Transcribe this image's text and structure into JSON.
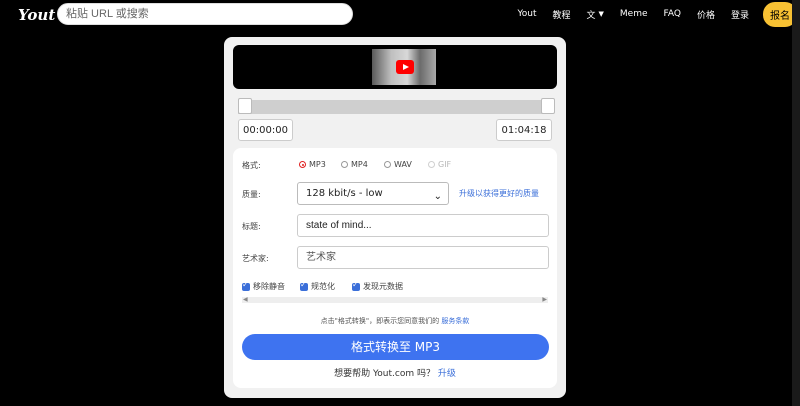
{
  "header": {
    "logo_text": "Yout",
    "search_placeholder": "粘贴 URL 或搜索",
    "nav": {
      "yout": "Yout",
      "tutorial": "教程",
      "language_icon": "文",
      "meme": "Meme",
      "faq": "FAQ",
      "pricing": "价格",
      "login": "登录",
      "signup": "报名"
    }
  },
  "player": {
    "start_time": "00:00:00",
    "end_time": "01:04:18"
  },
  "form": {
    "format_label": "格式:",
    "formats": [
      "MP3",
      "MP4",
      "WAV",
      "GIF"
    ],
    "selected_format": "MP3",
    "quality_label": "质量:",
    "quality_value": "128 kbit/s - low",
    "quality_upgrade": "升级以获得更好的质量",
    "title_label": "标题:",
    "title_value": "state of mind...",
    "artist_label": "艺术家:",
    "artist_placeholder": "艺术家",
    "checkboxes": [
      "移除静音",
      "规范化",
      "发现元数据"
    ],
    "terms_text": "点击\"格式转换\"，即表示您同意我们的",
    "terms_link": "服务条款",
    "convert_label": "格式转换至 MP3",
    "help_text": "想要帮助 Yout.com 吗？",
    "help_link": "升级"
  },
  "colors": {
    "accent": "#3e73f0",
    "signup": "#f8c133",
    "radio_selected": "#e02020"
  }
}
